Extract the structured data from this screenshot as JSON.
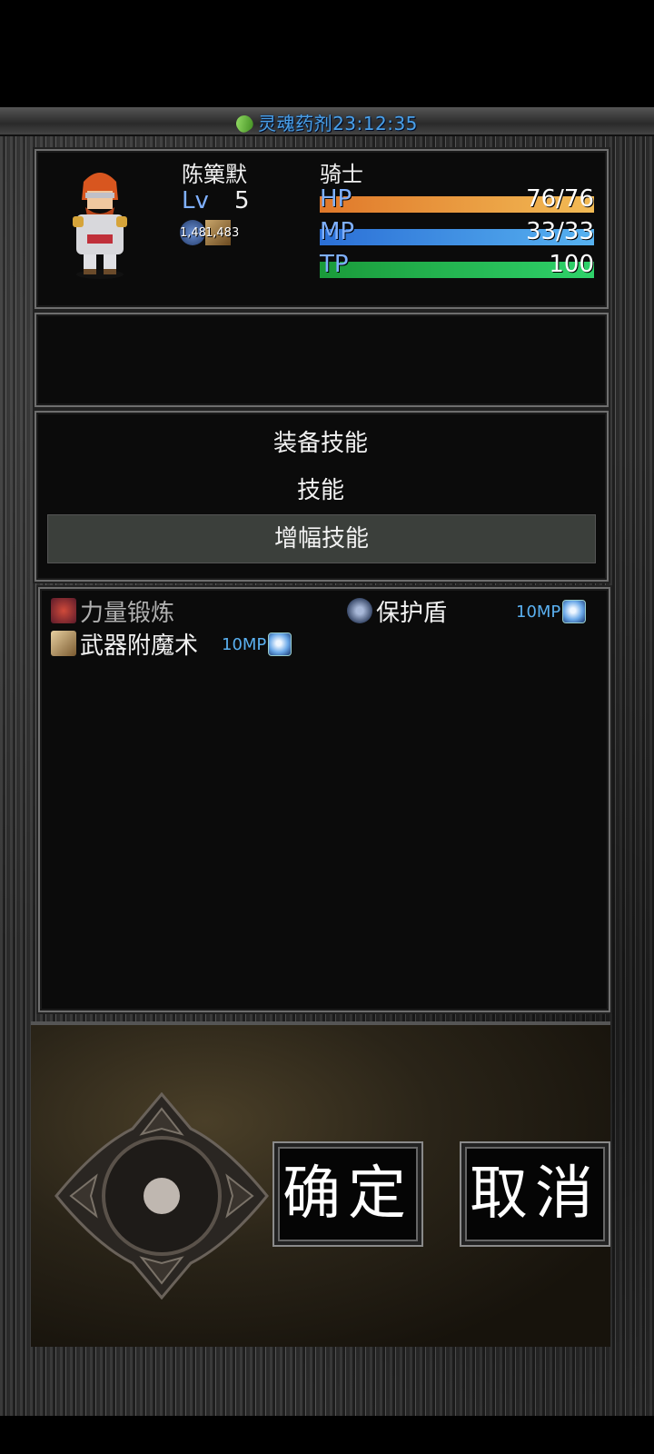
{
  "timer": {
    "label": "灵魂药剂23:12:35"
  },
  "actor": {
    "name": "陈篥默",
    "class": "骑士",
    "level_label": "Lv",
    "level": "5",
    "state_numbers": [
      "1,483",
      "1,483"
    ],
    "gauges": {
      "hp": {
        "label": "HP",
        "value": "76/76",
        "ratio": 1.0
      },
      "mp": {
        "label": "MP",
        "value": "33/33",
        "ratio": 1.0
      },
      "tp": {
        "label": "TP",
        "value": "100",
        "ratio": 1.0
      }
    }
  },
  "skill_types": [
    "装备技能",
    "技能",
    "增幅技能"
  ],
  "selected_skill_type": 2,
  "skills": [
    {
      "name": "力量锻炼",
      "cost": "",
      "enabled": false
    },
    {
      "name": "保护盾",
      "cost": "10MP",
      "enabled": true
    },
    {
      "name": "武器附魔术",
      "cost": "10MP",
      "enabled": true
    }
  ],
  "buttons": {
    "ok": "确定",
    "cancel": "取消"
  }
}
